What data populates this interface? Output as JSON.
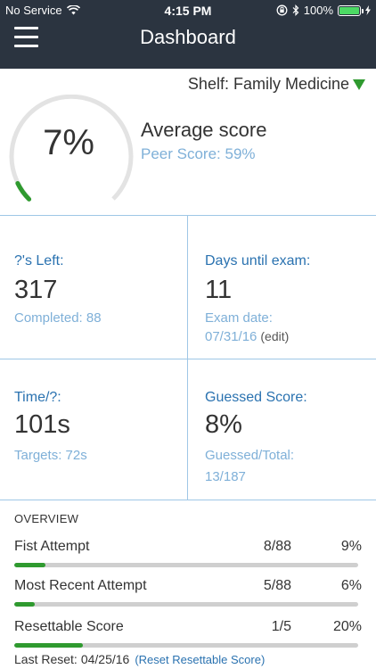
{
  "status_bar": {
    "carrier": "No Service",
    "time": "4:15 PM",
    "battery": "100%"
  },
  "nav": {
    "title": "Dashboard"
  },
  "shelf": {
    "label": "Shelf: Family Medicine"
  },
  "score": {
    "value": "7%",
    "fraction": 0.07,
    "label": "Average score",
    "peer": "Peer Score: 59%"
  },
  "grid": {
    "questions_left_label": "?'s Left:",
    "questions_left_value": "317",
    "completed": "Completed: 88",
    "days_label": "Days until exam:",
    "days_value": "11",
    "exam_date_label": "Exam date:",
    "exam_date": "07/31/16",
    "edit_label": "(edit)",
    "time_label": "Time/?:",
    "time_value": "101s",
    "targets": "Targets: 72s",
    "guessed_label": "Guessed Score:",
    "guessed_value": "8%",
    "guessed_total_label": "Guessed/Total:",
    "guessed_total": "13/187"
  },
  "overview": {
    "title": "OVERVIEW",
    "rows": [
      {
        "label": "Fist Attempt",
        "count": "8/88",
        "pct": "9%",
        "fraction": 0.09
      },
      {
        "label": "Most Recent Attempt",
        "count": "5/88",
        "pct": "6%",
        "fraction": 0.06
      },
      {
        "label": "Resettable Score",
        "count": "1/5",
        "pct": "20%",
        "fraction": 0.2
      }
    ]
  },
  "reset": {
    "label": "Last Reset:",
    "date": "04/25/16",
    "link": "(Reset Resettable Score)"
  },
  "colors": {
    "accent_green": "#2f9a2f",
    "label_blue": "#2a72b0",
    "sub_blue": "#7fb0d8",
    "header_bg": "#2b3440"
  }
}
